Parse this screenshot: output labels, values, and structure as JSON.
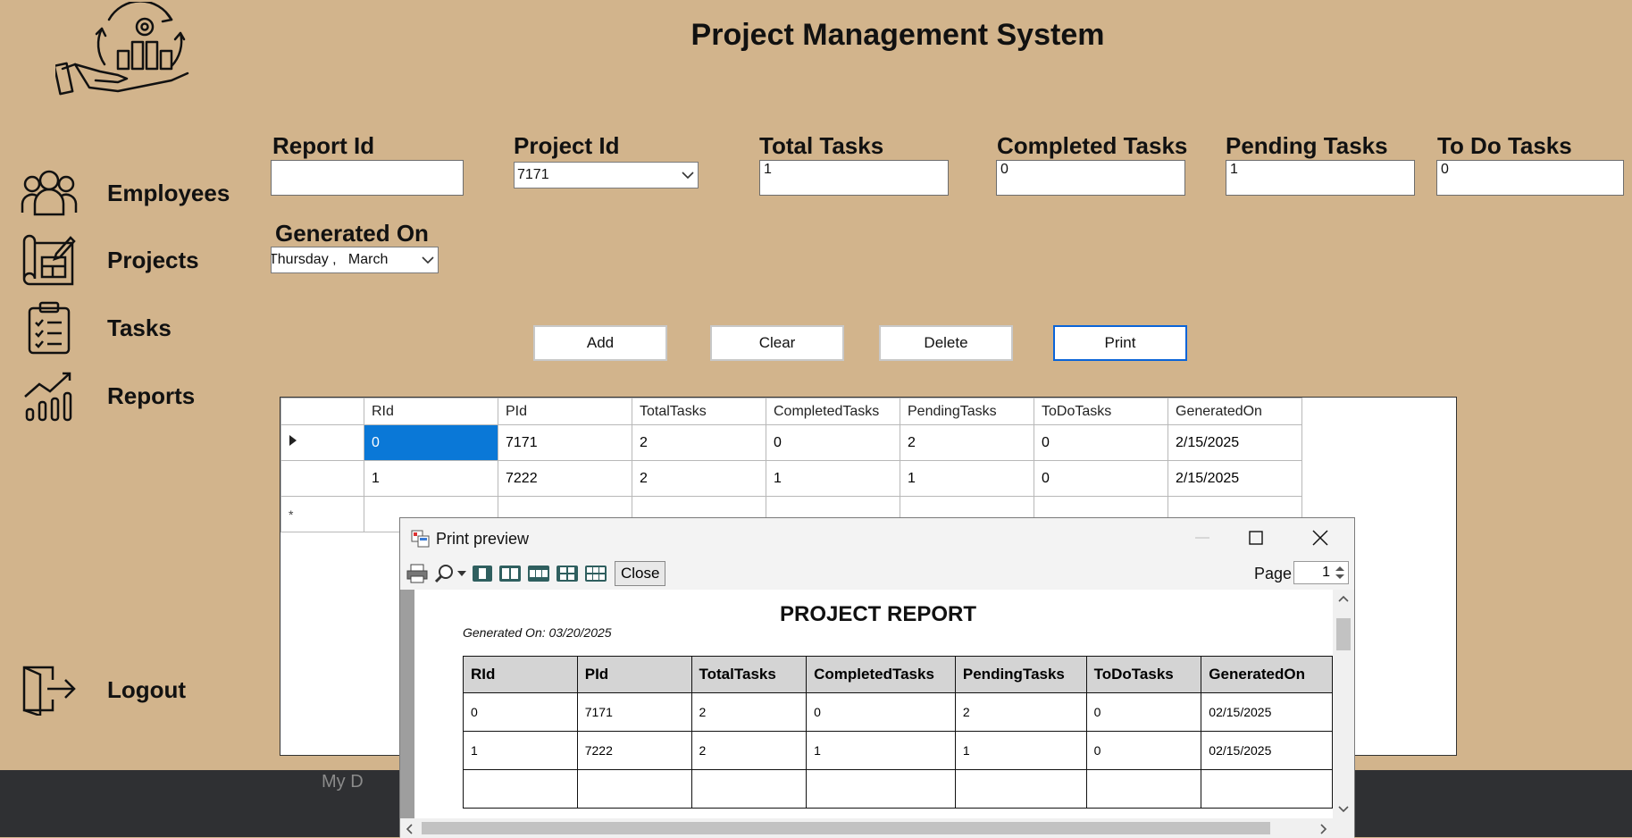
{
  "app": {
    "title": "Project Management System"
  },
  "sidebar": {
    "items": [
      {
        "label": "Employees",
        "icon": "employees-icon"
      },
      {
        "label": "Projects",
        "icon": "projects-icon"
      },
      {
        "label": "Tasks",
        "icon": "tasks-icon"
      },
      {
        "label": "Reports",
        "icon": "reports-icon"
      }
    ],
    "logout": {
      "label": "Logout",
      "icon": "logout-icon"
    }
  },
  "form": {
    "report_id": {
      "label": "Report Id",
      "value": ""
    },
    "project_id": {
      "label": "Project Id",
      "value": "7171"
    },
    "total_tasks": {
      "label": "Total Tasks",
      "value": "1"
    },
    "completed_tasks": {
      "label": "Completed Tasks",
      "value": "0"
    },
    "pending_tasks": {
      "label": "Pending Tasks",
      "value": "1"
    },
    "todo_tasks": {
      "label": "To Do Tasks",
      "value": "0"
    },
    "generated_on": {
      "label": "Generated On",
      "value": "Thursday ,   March"
    }
  },
  "buttons": {
    "add": "Add",
    "clear": "Clear",
    "delete": "Delete",
    "print": "Print"
  },
  "grid": {
    "columns": [
      "RId",
      "PId",
      "TotalTasks",
      "CompletedTasks",
      "PendingTasks",
      "ToDoTasks",
      "GeneratedOn"
    ],
    "rows": [
      [
        "0",
        "7171",
        "2",
        "0",
        "2",
        "0",
        "2/15/2025"
      ],
      [
        "1",
        "7222",
        "2",
        "1",
        "1",
        "0",
        "2/15/2025"
      ]
    ],
    "new_row_marker": "*"
  },
  "taskbar": {
    "text": "My D"
  },
  "print_preview": {
    "window_title": "Print preview",
    "close_label": "Close",
    "page_label": "Page",
    "page_value": "1",
    "report_title": "PROJECT REPORT",
    "generated_text": "Generated On: 03/20/2025",
    "columns": [
      "RId",
      "PId",
      "TotalTasks",
      "CompletedTasks",
      "PendingTasks",
      "ToDoTasks",
      "GeneratedOn"
    ],
    "rows": [
      [
        "0",
        "7171",
        "2",
        "0",
        "2",
        "0",
        "02/15/2025"
      ],
      [
        "1",
        "7222",
        "2",
        "1",
        "1",
        "0",
        "02/15/2025"
      ]
    ]
  },
  "colors": {
    "background": "#d2b48c",
    "selection": "#0a78d7",
    "focus_border": "#0a64d8"
  }
}
